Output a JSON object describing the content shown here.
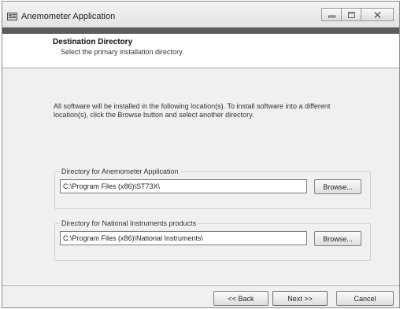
{
  "window": {
    "title": "Anemometer Application",
    "icon": "installer-app-icon",
    "controls": [
      "minimize-icon",
      "maximize-icon",
      "close-icon"
    ]
  },
  "header": {
    "title": "Destination Directory",
    "subtitle": "Select the primary installation directory."
  },
  "main": {
    "description": "All software will be installed in the following location(s). To install software into a different location(s), click the Browse button and select another directory."
  },
  "directories": [
    {
      "label": "Directory for Anemometer Application",
      "path": "C:\\Program Files (x86)\\ST73X\\",
      "browse_label": "Browse..."
    },
    {
      "label": "Directory for National Instruments products",
      "path": "C:\\Program Files (x86)\\National Instruments\\",
      "browse_label": "Browse..."
    }
  ],
  "footer": {
    "back_label": "<< Back",
    "next_label": "Next >>",
    "cancel_label": "Cancel"
  }
}
